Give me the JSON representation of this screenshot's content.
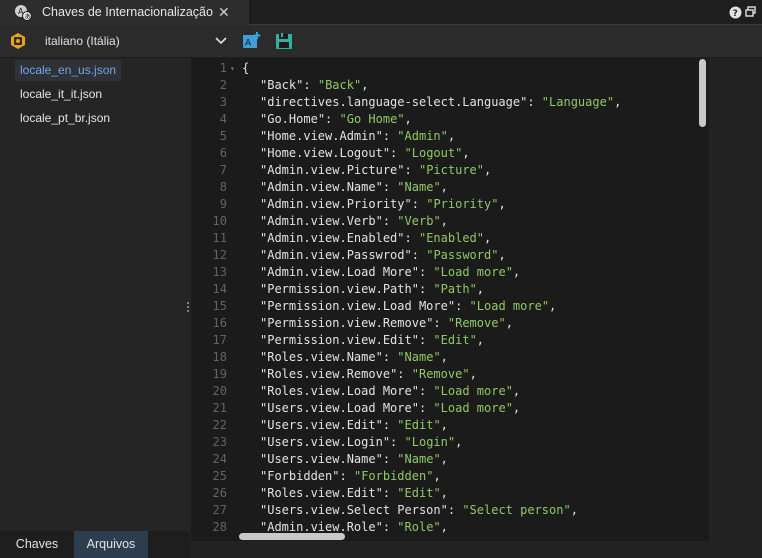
{
  "window": {
    "tab_title": "Chaves de Internacionalização",
    "close_glyph": "✕"
  },
  "toolbar": {
    "language_select_value": "italiano (Itália)"
  },
  "sidebar": {
    "files": [
      {
        "label": "locale_en_us.json",
        "active": true
      },
      {
        "label": "locale_it_it.json",
        "active": false
      },
      {
        "label": "locale_pt_br.json",
        "active": false
      }
    ],
    "bottom_tabs": [
      {
        "label": "Chaves",
        "active": false
      },
      {
        "label": "Arquivos",
        "active": true
      }
    ]
  },
  "editor": {
    "lines": [
      {
        "n": "1",
        "key": "{",
        "value": "",
        "brace": true
      },
      {
        "n": "2",
        "key": "Back",
        "value": "Back"
      },
      {
        "n": "3",
        "key": "directives.language-select.Language",
        "value": "Language"
      },
      {
        "n": "4",
        "key": "Go.Home",
        "value": "Go Home"
      },
      {
        "n": "5",
        "key": "Home.view.Admin",
        "value": "Admin"
      },
      {
        "n": "6",
        "key": "Home.view.Logout",
        "value": "Logout"
      },
      {
        "n": "7",
        "key": "Admin.view.Picture",
        "value": "Picture"
      },
      {
        "n": "8",
        "key": "Admin.view.Name",
        "value": "Name"
      },
      {
        "n": "9",
        "key": "Admin.view.Priority",
        "value": "Priority"
      },
      {
        "n": "10",
        "key": "Admin.view.Verb",
        "value": "Verb"
      },
      {
        "n": "11",
        "key": "Admin.view.Enabled",
        "value": "Enabled"
      },
      {
        "n": "12",
        "key": "Admin.view.Passwrod",
        "value": "Password"
      },
      {
        "n": "13",
        "key": "Admin.view.Load More",
        "value": "Load more"
      },
      {
        "n": "14",
        "key": "Permission.view.Path",
        "value": "Path"
      },
      {
        "n": "15",
        "key": "Permission.view.Load More",
        "value": "Load more"
      },
      {
        "n": "16",
        "key": "Permission.view.Remove",
        "value": "Remove"
      },
      {
        "n": "17",
        "key": "Permission.view.Edit",
        "value": "Edit"
      },
      {
        "n": "18",
        "key": "Roles.view.Name",
        "value": "Name"
      },
      {
        "n": "19",
        "key": "Roles.view.Remove",
        "value": "Remove"
      },
      {
        "n": "20",
        "key": "Roles.view.Load More",
        "value": "Load more"
      },
      {
        "n": "21",
        "key": "Users.view.Load More",
        "value": "Load more"
      },
      {
        "n": "22",
        "key": "Users.view.Edit",
        "value": "Edit"
      },
      {
        "n": "23",
        "key": "Users.view.Login",
        "value": "Login"
      },
      {
        "n": "24",
        "key": "Users.view.Name",
        "value": "Name"
      },
      {
        "n": "25",
        "key": "Forbidden",
        "value": "Forbidden"
      },
      {
        "n": "26",
        "key": "Roles.view.Edit",
        "value": "Edit"
      },
      {
        "n": "27",
        "key": "Users.view.Select Person",
        "value": "Select person"
      },
      {
        "n": "28",
        "key": "Admin.view.Role",
        "value": "Role"
      }
    ]
  },
  "colors": {
    "string": "#8ec962",
    "active_file": "#6fa6ea",
    "accent_icon": "#e8a317",
    "toolbar_icon": "#3c9fd6"
  }
}
